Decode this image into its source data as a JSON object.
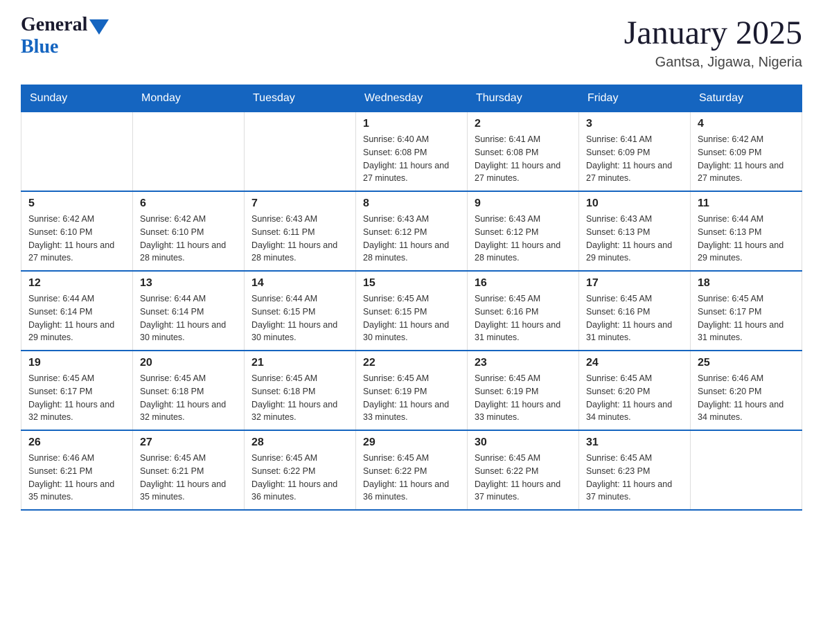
{
  "logo": {
    "general": "General",
    "blue": "Blue"
  },
  "title": "January 2025",
  "location": "Gantsa, Jigawa, Nigeria",
  "days_of_week": [
    "Sunday",
    "Monday",
    "Tuesday",
    "Wednesday",
    "Thursday",
    "Friday",
    "Saturday"
  ],
  "weeks": [
    [
      {
        "day": "",
        "info": ""
      },
      {
        "day": "",
        "info": ""
      },
      {
        "day": "",
        "info": ""
      },
      {
        "day": "1",
        "info": "Sunrise: 6:40 AM\nSunset: 6:08 PM\nDaylight: 11 hours and 27 minutes."
      },
      {
        "day": "2",
        "info": "Sunrise: 6:41 AM\nSunset: 6:08 PM\nDaylight: 11 hours and 27 minutes."
      },
      {
        "day": "3",
        "info": "Sunrise: 6:41 AM\nSunset: 6:09 PM\nDaylight: 11 hours and 27 minutes."
      },
      {
        "day": "4",
        "info": "Sunrise: 6:42 AM\nSunset: 6:09 PM\nDaylight: 11 hours and 27 minutes."
      }
    ],
    [
      {
        "day": "5",
        "info": "Sunrise: 6:42 AM\nSunset: 6:10 PM\nDaylight: 11 hours and 27 minutes."
      },
      {
        "day": "6",
        "info": "Sunrise: 6:42 AM\nSunset: 6:10 PM\nDaylight: 11 hours and 28 minutes."
      },
      {
        "day": "7",
        "info": "Sunrise: 6:43 AM\nSunset: 6:11 PM\nDaylight: 11 hours and 28 minutes."
      },
      {
        "day": "8",
        "info": "Sunrise: 6:43 AM\nSunset: 6:12 PM\nDaylight: 11 hours and 28 minutes."
      },
      {
        "day": "9",
        "info": "Sunrise: 6:43 AM\nSunset: 6:12 PM\nDaylight: 11 hours and 28 minutes."
      },
      {
        "day": "10",
        "info": "Sunrise: 6:43 AM\nSunset: 6:13 PM\nDaylight: 11 hours and 29 minutes."
      },
      {
        "day": "11",
        "info": "Sunrise: 6:44 AM\nSunset: 6:13 PM\nDaylight: 11 hours and 29 minutes."
      }
    ],
    [
      {
        "day": "12",
        "info": "Sunrise: 6:44 AM\nSunset: 6:14 PM\nDaylight: 11 hours and 29 minutes."
      },
      {
        "day": "13",
        "info": "Sunrise: 6:44 AM\nSunset: 6:14 PM\nDaylight: 11 hours and 30 minutes."
      },
      {
        "day": "14",
        "info": "Sunrise: 6:44 AM\nSunset: 6:15 PM\nDaylight: 11 hours and 30 minutes."
      },
      {
        "day": "15",
        "info": "Sunrise: 6:45 AM\nSunset: 6:15 PM\nDaylight: 11 hours and 30 minutes."
      },
      {
        "day": "16",
        "info": "Sunrise: 6:45 AM\nSunset: 6:16 PM\nDaylight: 11 hours and 31 minutes."
      },
      {
        "day": "17",
        "info": "Sunrise: 6:45 AM\nSunset: 6:16 PM\nDaylight: 11 hours and 31 minutes."
      },
      {
        "day": "18",
        "info": "Sunrise: 6:45 AM\nSunset: 6:17 PM\nDaylight: 11 hours and 31 minutes."
      }
    ],
    [
      {
        "day": "19",
        "info": "Sunrise: 6:45 AM\nSunset: 6:17 PM\nDaylight: 11 hours and 32 minutes."
      },
      {
        "day": "20",
        "info": "Sunrise: 6:45 AM\nSunset: 6:18 PM\nDaylight: 11 hours and 32 minutes."
      },
      {
        "day": "21",
        "info": "Sunrise: 6:45 AM\nSunset: 6:18 PM\nDaylight: 11 hours and 32 minutes."
      },
      {
        "day": "22",
        "info": "Sunrise: 6:45 AM\nSunset: 6:19 PM\nDaylight: 11 hours and 33 minutes."
      },
      {
        "day": "23",
        "info": "Sunrise: 6:45 AM\nSunset: 6:19 PM\nDaylight: 11 hours and 33 minutes."
      },
      {
        "day": "24",
        "info": "Sunrise: 6:45 AM\nSunset: 6:20 PM\nDaylight: 11 hours and 34 minutes."
      },
      {
        "day": "25",
        "info": "Sunrise: 6:46 AM\nSunset: 6:20 PM\nDaylight: 11 hours and 34 minutes."
      }
    ],
    [
      {
        "day": "26",
        "info": "Sunrise: 6:46 AM\nSunset: 6:21 PM\nDaylight: 11 hours and 35 minutes."
      },
      {
        "day": "27",
        "info": "Sunrise: 6:45 AM\nSunset: 6:21 PM\nDaylight: 11 hours and 35 minutes."
      },
      {
        "day": "28",
        "info": "Sunrise: 6:45 AM\nSunset: 6:22 PM\nDaylight: 11 hours and 36 minutes."
      },
      {
        "day": "29",
        "info": "Sunrise: 6:45 AM\nSunset: 6:22 PM\nDaylight: 11 hours and 36 minutes."
      },
      {
        "day": "30",
        "info": "Sunrise: 6:45 AM\nSunset: 6:22 PM\nDaylight: 11 hours and 37 minutes."
      },
      {
        "day": "31",
        "info": "Sunrise: 6:45 AM\nSunset: 6:23 PM\nDaylight: 11 hours and 37 minutes."
      },
      {
        "day": "",
        "info": ""
      }
    ]
  ]
}
